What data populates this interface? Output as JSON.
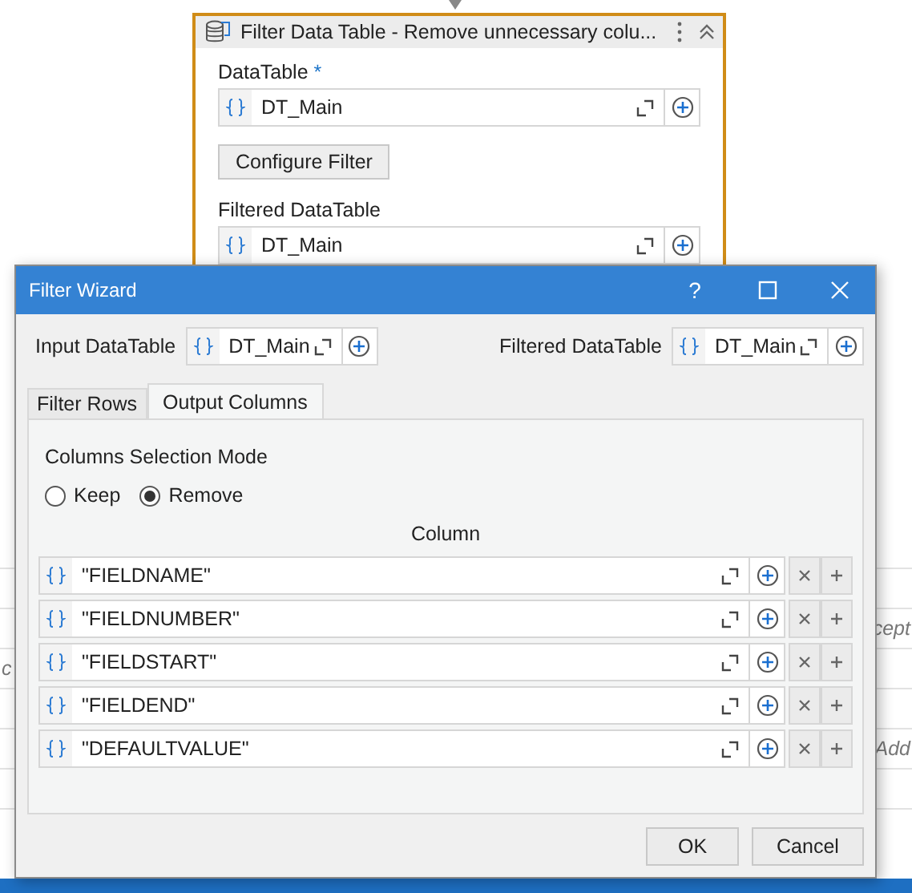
{
  "activity": {
    "title": "Filter Data Table - Remove unnecessary colu...",
    "datatable_label": "DataTable",
    "required_mark": "*",
    "datatable": {
      "value": "DT_Main"
    },
    "configure_button": "Configure Filter",
    "filtered_label": "Filtered DataTable",
    "filtered": {
      "value": "DT_Main"
    }
  },
  "dialog": {
    "title": "Filter Wizard",
    "help": "?",
    "input_label": "Input DataTable",
    "input": {
      "value": "DT_Main"
    },
    "output_label": "Filtered DataTable",
    "output": {
      "value": "DT_Main"
    },
    "tabs": [
      {
        "label": "Filter Rows",
        "selected": false
      },
      {
        "label": "Output Columns",
        "selected": true
      }
    ],
    "mode_label": "Columns Selection Mode",
    "modes": [
      {
        "label": "Keep",
        "selected": false
      },
      {
        "label": "Remove",
        "selected": true
      }
    ],
    "column_header": "Column",
    "columns": [
      {
        "value": "\"FIELDNAME\""
      },
      {
        "value": "\"FIELDNUMBER\""
      },
      {
        "value": "\"FIELDSTART\""
      },
      {
        "value": "\"FIELDEND\""
      },
      {
        "value": "\"DEFAULTVALUE\""
      }
    ],
    "buttons": [
      "OK",
      "Cancel"
    ]
  },
  "background_texts": [
    "c",
    "cept",
    "Add"
  ]
}
